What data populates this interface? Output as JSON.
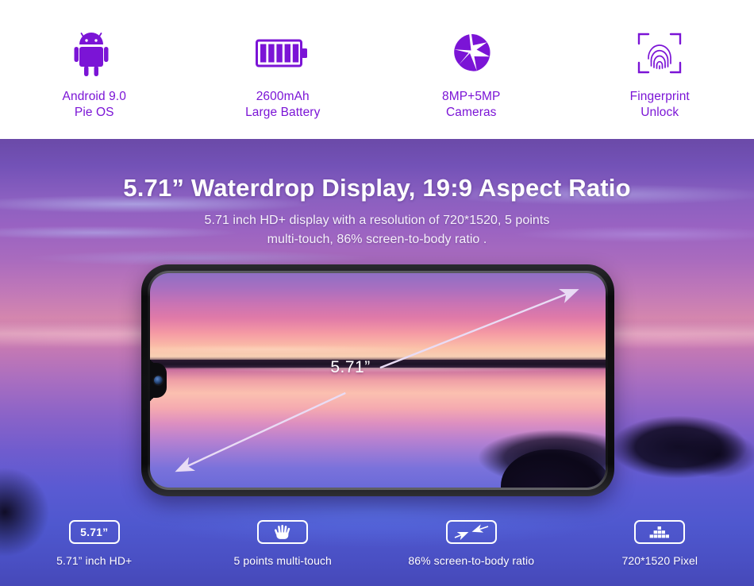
{
  "specs": [
    {
      "icon": "android-robot-icon",
      "line1": "Android 9.0",
      "line2": "Pie OS"
    },
    {
      "icon": "battery-icon",
      "line1": "2600mAh",
      "line2": "Large Battery"
    },
    {
      "icon": "camera-aperture-icon",
      "line1": "8MP+5MP",
      "line2": "Cameras"
    },
    {
      "icon": "fingerprint-icon",
      "line1": "Fingerprint",
      "line2": "Unlock"
    }
  ],
  "hero": {
    "title": "5.71” Waterdrop Display, 19:9 Aspect Ratio",
    "subtitle_line1": "5.71 inch HD+ display with a resolution of 720*1520, 5 points",
    "subtitle_line2": "multi-touch, 86% screen-to-body ratio .",
    "diagonal_label": "5.71”"
  },
  "features": [
    {
      "icon": "screen-size-icon",
      "box_text": "5.71”",
      "label": "5.71” inch HD+"
    },
    {
      "icon": "hand-multitouch-icon",
      "box_text": "",
      "label": "5 points multi-touch"
    },
    {
      "icon": "screen-to-body-arrows-icon",
      "box_text": "",
      "label": "86% screen-to-body ratio"
    },
    {
      "icon": "pixel-grid-icon",
      "box_text": "",
      "label": "720*1520 Pixel"
    }
  ],
  "colors": {
    "accent_purple": "#7b14d6",
    "white": "#ffffff",
    "top_bar_bg": "#ffffff"
  }
}
